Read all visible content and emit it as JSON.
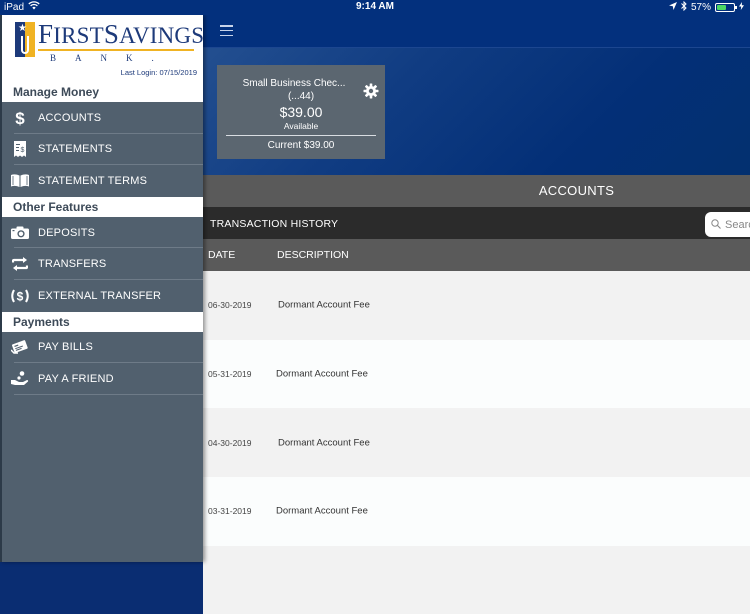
{
  "status_bar": {
    "device": "iPad",
    "time": "9:14 AM",
    "battery_percent": "57%",
    "battery_level": 0.57,
    "icons": [
      "wifi-icon",
      "location-icon",
      "bluetooth-icon",
      "battery-icon",
      "charging-icon"
    ]
  },
  "colors": {
    "brand_blue": "#03307d",
    "brand_gold": "#f0b323",
    "sidebar_bg": "#51606e",
    "accounts_bar": "#5a5a5a",
    "history_bar": "#2b2b2b",
    "battery_green": "#4cd964"
  },
  "sidebar": {
    "logo": {
      "name_first": "First",
      "name_second": "Savings",
      "sub": "BANK."
    },
    "last_login_label": "Last Login:",
    "last_login_value": "07/15/2019",
    "sections": [
      {
        "title": "Manage Money",
        "items": [
          {
            "label": "ACCOUNTS",
            "icon": "dollar-icon"
          },
          {
            "label": "STATEMENTS",
            "icon": "statement-icon"
          },
          {
            "label": "STATEMENT TERMS",
            "icon": "book-icon"
          }
        ]
      },
      {
        "title": "Other Features",
        "items": [
          {
            "label": "DEPOSITS",
            "icon": "camera-icon"
          },
          {
            "label": "TRANSFERS",
            "icon": "transfer-arrows-icon"
          },
          {
            "label": "EXTERNAL TRANSFER",
            "icon": "external-transfer-icon"
          }
        ]
      },
      {
        "title": "Payments",
        "items": [
          {
            "label": "PAY BILLS",
            "icon": "bills-icon"
          },
          {
            "label": "PAY A FRIEND",
            "icon": "pay-friend-icon"
          }
        ]
      }
    ]
  },
  "main": {
    "account_card": {
      "name": "Small Business Chec...",
      "number": "(...44)",
      "balance": "$39.00",
      "balance_label": "Available",
      "current": "Current $39.00"
    },
    "accounts_title": "ACCOUNTS",
    "history_title": "TRANSACTION HISTORY",
    "search_placeholder": "Search",
    "columns": {
      "date": "DATE",
      "description": "DESCRIPTION"
    },
    "transactions": [
      {
        "date": "06-30-2019",
        "description": "Dormant Account Fee"
      },
      {
        "date": "05-31-2019",
        "description": "Dormant Account Fee"
      },
      {
        "date": "04-30-2019",
        "description": "Dormant Account Fee"
      },
      {
        "date": "03-31-2019",
        "description": "Dormant Account Fee"
      },
      {
        "date": "",
        "description": ""
      }
    ]
  }
}
